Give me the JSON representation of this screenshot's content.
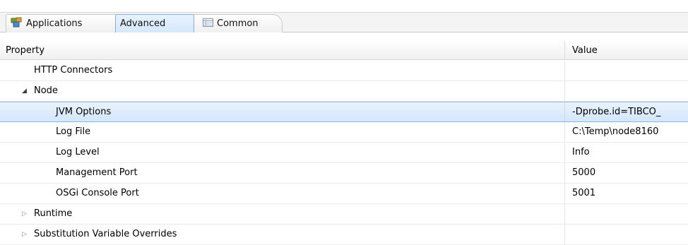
{
  "tabs": [
    {
      "label": "Applications",
      "icon": "applications-icon"
    },
    {
      "label": "Advanced",
      "icon": ""
    },
    {
      "label": "Common",
      "icon": "table-icon"
    }
  ],
  "table": {
    "headers": {
      "property": "Property",
      "value": "Value"
    },
    "rows": [
      {
        "label": "HTTP Connectors",
        "value": "",
        "toggle": ""
      },
      {
        "label": "Node",
        "value": "",
        "toggle": "◢"
      },
      {
        "label": "JVM Options",
        "value": "-Dprobe.id=TIBCO_",
        "toggle": ""
      },
      {
        "label": "Log File",
        "value": "C:\\Temp\\node8160",
        "toggle": ""
      },
      {
        "label": "Log Level",
        "value": "Info",
        "toggle": ""
      },
      {
        "label": "Management Port",
        "value": "5000",
        "toggle": ""
      },
      {
        "label": "OSGi Console Port",
        "value": "5001",
        "toggle": ""
      },
      {
        "label": "Runtime",
        "value": "",
        "toggle": "▷"
      },
      {
        "label": "Substitution Variable Overrides",
        "value": "",
        "toggle": "▷"
      }
    ]
  },
  "colors": {
    "selected_row": "#d3e6fb",
    "tab_active": "#d6e8fb",
    "border": "#c8c8c8"
  }
}
